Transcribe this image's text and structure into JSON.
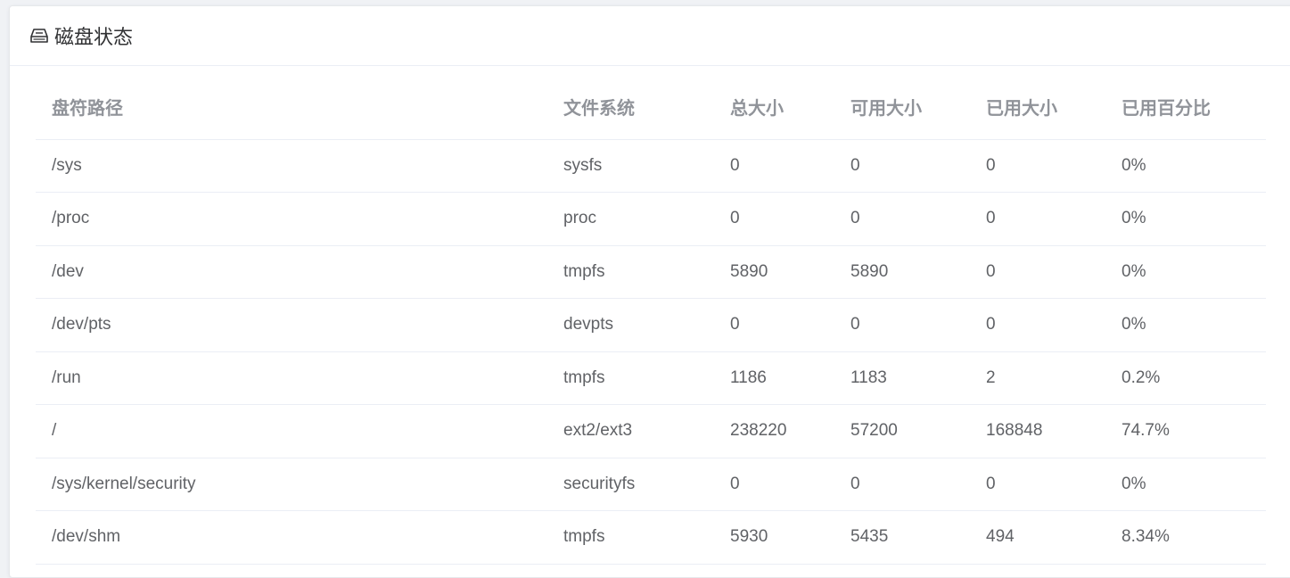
{
  "card": {
    "title": "磁盘状态",
    "icon": "hard-drive-icon"
  },
  "table": {
    "headers": [
      "盘符路径",
      "文件系统",
      "总大小",
      "可用大小",
      "已用大小",
      "已用百分比"
    ],
    "rows": [
      [
        "/sys",
        "sysfs",
        "0",
        "0",
        "0",
        "0%"
      ],
      [
        "/proc",
        "proc",
        "0",
        "0",
        "0",
        "0%"
      ],
      [
        "/dev",
        "tmpfs",
        "5890",
        "5890",
        "0",
        "0%"
      ],
      [
        "/dev/pts",
        "devpts",
        "0",
        "0",
        "0",
        "0%"
      ],
      [
        "/run",
        "tmpfs",
        "1186",
        "1183",
        "2",
        "0.2%"
      ],
      [
        "/",
        "ext2/ext3",
        "238220",
        "57200",
        "168848",
        "74.7%"
      ],
      [
        "/sys/kernel/security",
        "securityfs",
        "0",
        "0",
        "0",
        "0%"
      ],
      [
        "/dev/shm",
        "tmpfs",
        "5930",
        "5435",
        "494",
        "8.34%"
      ]
    ]
  }
}
